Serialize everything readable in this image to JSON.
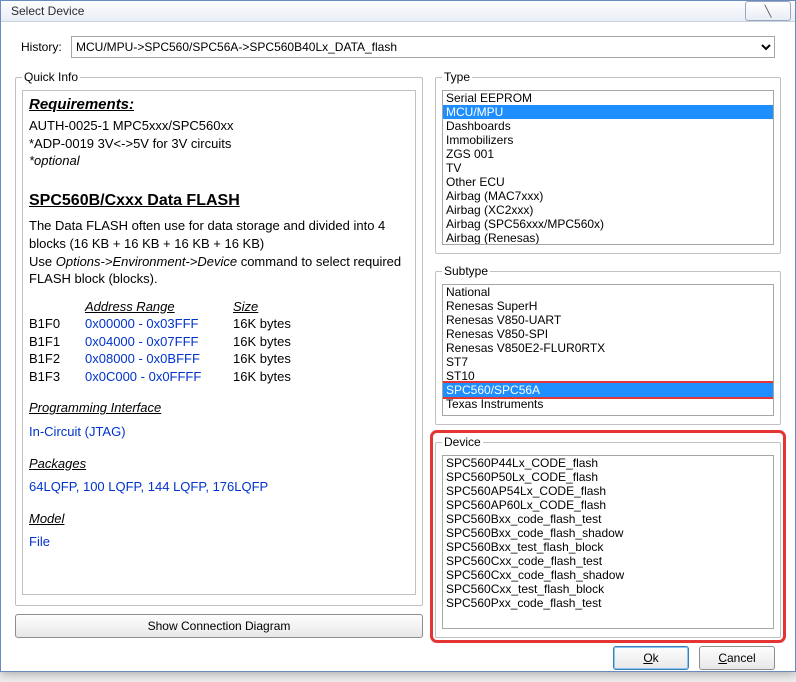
{
  "title": "Select Device",
  "close_glyph": "╲",
  "history": {
    "label": "History:",
    "value": "MCU/MPU->SPC560/SPC56A->SPC560B40Lx_DATA_flash"
  },
  "quickinfo": {
    "legend": "Quick Info",
    "requirements_h": "Requirements:",
    "req_line1": "AUTH-0025-1 MPC5xxx/SPC560xx",
    "req_line2": "*ADP-0019 3V<->5V for 3V circuits",
    "req_line3": "*optional",
    "flash_h": "SPC560B/Cxxx Data FLASH",
    "flash_p1": "The Data FLASH often use for data storage and divided into 4 blocks (16 KB + 16 KB + 16 KB + 16 KB)",
    "flash_p2a": "Use ",
    "flash_p2b": "Options->Environment->Device",
    "flash_p2c": " command to select required FLASH block (blocks).",
    "addr_h1": "Address Range",
    "addr_h2": "Size",
    "addr_rows": [
      {
        "id": "B1F0",
        "range": "0x00000 - 0x03FFF",
        "size": "16K bytes"
      },
      {
        "id": "B1F1",
        "range": "0x04000 - 0x07FFF",
        "size": "16K bytes"
      },
      {
        "id": "B1F2",
        "range": "0x08000 - 0x0BFFF",
        "size": "16K bytes"
      },
      {
        "id": "B1F3",
        "range": "0x0C000 - 0x0FFFF",
        "size": "16K bytes"
      }
    ],
    "prog_if_h": "Programming Interface",
    "prog_if_v": "In-Circuit (JTAG)",
    "packages_h": "Packages",
    "packages_v": "64LQFP, 100 LQFP, 144 LQFP, 176LQFP",
    "model_h": "Model",
    "model_v": "File"
  },
  "show_conn": "Show Connection Diagram",
  "type": {
    "legend": "Type",
    "items": [
      "Serial EEPROM",
      "MCU/MPU",
      "Dashboards",
      "Immobilizers",
      "ZGS 001",
      "TV",
      "Other ECU",
      "Airbag (MAC7xxx)",
      "Airbag (XC2xxx)",
      "Airbag (SPC56xxx/MPC560x)",
      "Airbag (Renesas)"
    ],
    "selected_index": 1
  },
  "subtype": {
    "legend": "Subtype",
    "items": [
      "National",
      "Renesas SuperH",
      "Renesas V850-UART",
      "Renesas V850-SPI",
      "Renesas V850E2-FLUR0RTX",
      "ST7",
      "ST10",
      "SPC560/SPC56A",
      "Texas Instruments"
    ],
    "selected_index": 7
  },
  "device": {
    "legend": "Device",
    "items": [
      "SPC560P44Lx_CODE_flash",
      "SPC560P50Lx_CODE_flash",
      "SPC560AP54Lx_CODE_flash",
      "SPC560AP60Lx_CODE_flash",
      "SPC560Bxx_code_flash_test",
      "SPC560Bxx_code_flash_shadow",
      "SPC560Bxx_test_flash_block",
      "SPC560Cxx_code_flash_test",
      "SPC560Cxx_code_flash_shadow",
      "SPC560Cxx_test_flash_block",
      "SPC560Pxx_code_flash_test"
    ]
  },
  "buttons": {
    "ok_u": "O",
    "ok_rest": "k",
    "cancel_u": "C",
    "cancel_rest": "ancel"
  }
}
